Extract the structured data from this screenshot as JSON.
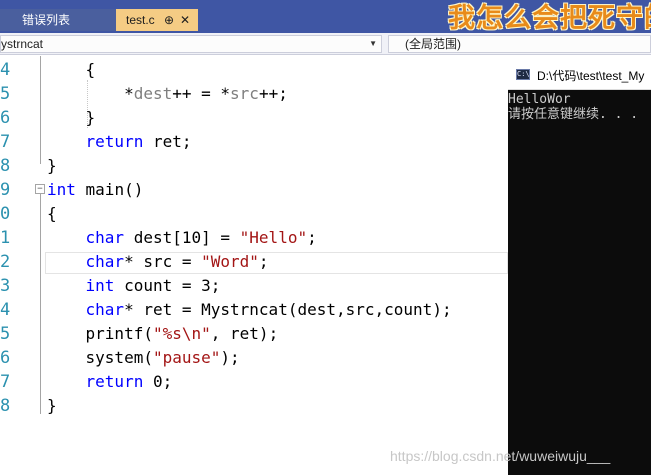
{
  "tabs": {
    "errors_label": "错误列表",
    "active_label": "test.c",
    "pin_glyph": "⊕",
    "close_glyph": "✕"
  },
  "banner_text": "我怎么会把死守的",
  "navbar": {
    "scope_value": "ystrncat",
    "member_value": "(全局范围)"
  },
  "editor": {
    "line_numbers": [
      "4",
      "5",
      "6",
      "7",
      "8",
      "9",
      "0",
      "1",
      "2",
      "3",
      "4",
      "5",
      "6",
      "7",
      "8"
    ],
    "lines": [
      [
        {
          "t": "    {",
          "c": ""
        }
      ],
      [
        {
          "t": "        *",
          "c": ""
        },
        {
          "t": "dest",
          "c": "var-dim"
        },
        {
          "t": "++ = *",
          "c": ""
        },
        {
          "t": "src",
          "c": "var-dim"
        },
        {
          "t": "++;",
          "c": ""
        }
      ],
      [
        {
          "t": "    }",
          "c": ""
        }
      ],
      [
        {
          "t": "    ",
          "c": ""
        },
        {
          "t": "return",
          "c": "kw"
        },
        {
          "t": " ret;",
          "c": ""
        }
      ],
      [
        {
          "t": "}",
          "c": ""
        }
      ],
      [
        {
          "t": "int",
          "c": "kw"
        },
        {
          "t": " main()",
          "c": ""
        }
      ],
      [
        {
          "t": "{",
          "c": ""
        }
      ],
      [
        {
          "t": "    ",
          "c": ""
        },
        {
          "t": "char",
          "c": "kw"
        },
        {
          "t": " dest[10] = ",
          "c": ""
        },
        {
          "t": "\"Hello\"",
          "c": "str"
        },
        {
          "t": ";",
          "c": ""
        }
      ],
      [
        {
          "t": "    ",
          "c": ""
        },
        {
          "t": "char",
          "c": "kw"
        },
        {
          "t": "* src = ",
          "c": ""
        },
        {
          "t": "\"Word\"",
          "c": "str"
        },
        {
          "t": ";",
          "c": ""
        }
      ],
      [
        {
          "t": "    ",
          "c": ""
        },
        {
          "t": "int",
          "c": "kw"
        },
        {
          "t": " count = 3;",
          "c": ""
        }
      ],
      [
        {
          "t": "    ",
          "c": ""
        },
        {
          "t": "char",
          "c": "kw"
        },
        {
          "t": "* ret = Mystrncat(dest,src,count);",
          "c": ""
        }
      ],
      [
        {
          "t": "    printf(",
          "c": ""
        },
        {
          "t": "\"%s\\n\"",
          "c": "str"
        },
        {
          "t": ", ret);",
          "c": ""
        }
      ],
      [
        {
          "t": "    system(",
          "c": ""
        },
        {
          "t": "\"pause\"",
          "c": "str"
        },
        {
          "t": ");",
          "c": ""
        }
      ],
      [
        {
          "t": "    ",
          "c": ""
        },
        {
          "t": "return",
          "c": "kw"
        },
        {
          "t": " 0;",
          "c": ""
        }
      ],
      [
        {
          "t": "}",
          "c": ""
        }
      ]
    ]
  },
  "console": {
    "icon_label": "C:\\",
    "title": "D:\\代码\\test\\test_My",
    "output_line1": "HelloWor",
    "output_line2": "请按任意键继续. . ."
  },
  "watermark": "https://blog.csdn.net/wuweiwuju___"
}
